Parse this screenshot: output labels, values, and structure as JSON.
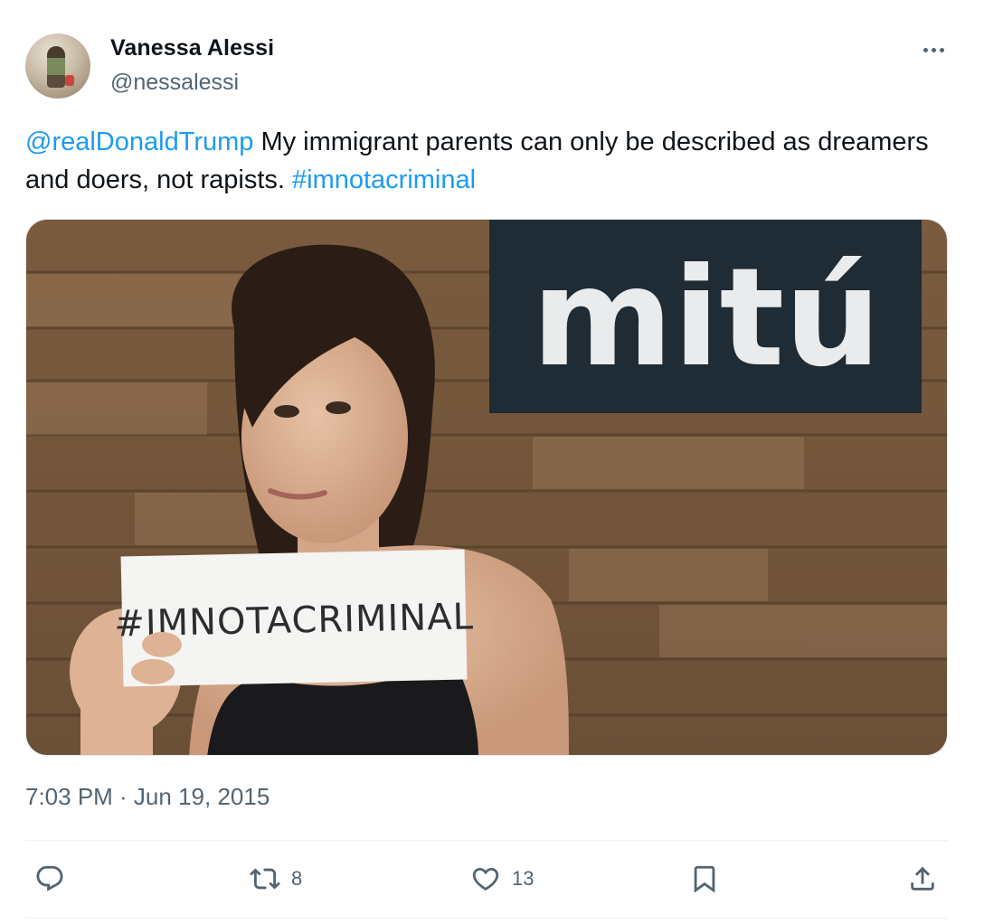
{
  "user": {
    "display_name": "Vanessa Alessi",
    "handle": "@nessalessi"
  },
  "tweet": {
    "mention": "@realDonaldTrump",
    "text_main": " My immigrant parents can only be described as dreamers and doers, not rapists. ",
    "hashtag": "#imnotacriminal",
    "timestamp": "7:03 PM · Jun 19, 2015"
  },
  "media": {
    "sign_text": "#IMNOTACRIMINAL",
    "logo_text": "mitú"
  },
  "actions": {
    "reply_count": "",
    "retweet_count": "8",
    "like_count": "13"
  },
  "icons": {
    "more": "more-icon",
    "reply": "reply-icon",
    "retweet": "retweet-icon",
    "like": "heart-icon",
    "bookmark": "bookmark-icon",
    "share": "share-icon"
  },
  "colors": {
    "link": "#1d9bf0",
    "secondary_text": "#536471",
    "primary_text": "#0f1419"
  }
}
